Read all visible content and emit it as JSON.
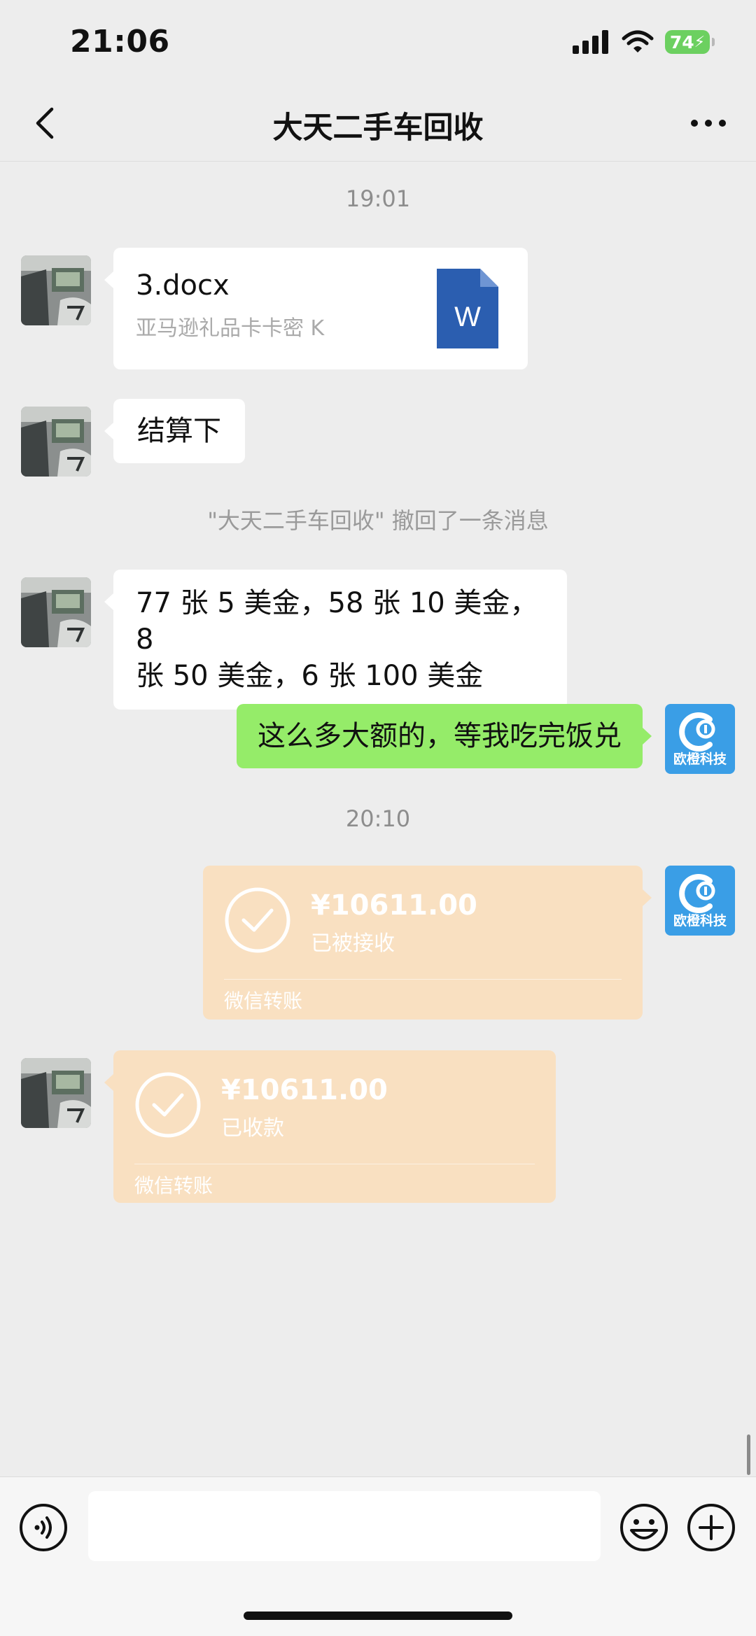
{
  "status_bar": {
    "time": "21:06",
    "battery": "74"
  },
  "header": {
    "title": "大天二手车回收"
  },
  "messages": {
    "time_1": "19:01",
    "file": {
      "name": "3.docx",
      "description": "亚马逊礼品卡卡密 K",
      "icon_letter": "W"
    },
    "text_1": "结算下",
    "recall_notice": "\"大天二手车回收\" 撤回了一条消息",
    "text_2_line1": "77 张 5 美金，58 张 10 美金，8",
    "text_2_line2": "张 50 美金，6 张 100 美金",
    "text_3": "这么多大额的，等我吃完饭兑",
    "time_2": "20:10",
    "transfer_sent": {
      "amount": "¥10611.00",
      "status": "已被接收",
      "label": "微信转账"
    },
    "transfer_received": {
      "amount": "¥10611.00",
      "status": "已收款",
      "label": "微信转账"
    }
  },
  "self_avatar": {
    "text": "欧橙科技"
  },
  "input": {
    "placeholder": ""
  },
  "colors": {
    "background": "#ededed",
    "my_bubble": "#95ec69",
    "transfer": "#f9e0c1",
    "avatar_blue": "#3a9ee6",
    "word_blue": "#2b5eb0"
  },
  "icons": {
    "back": "chevron-left-icon",
    "more": "more-dots-icon",
    "voice": "voice-icon",
    "emoji": "emoji-icon",
    "add": "plus-icon",
    "check": "check-circle-icon",
    "word": "word-doc-icon"
  }
}
